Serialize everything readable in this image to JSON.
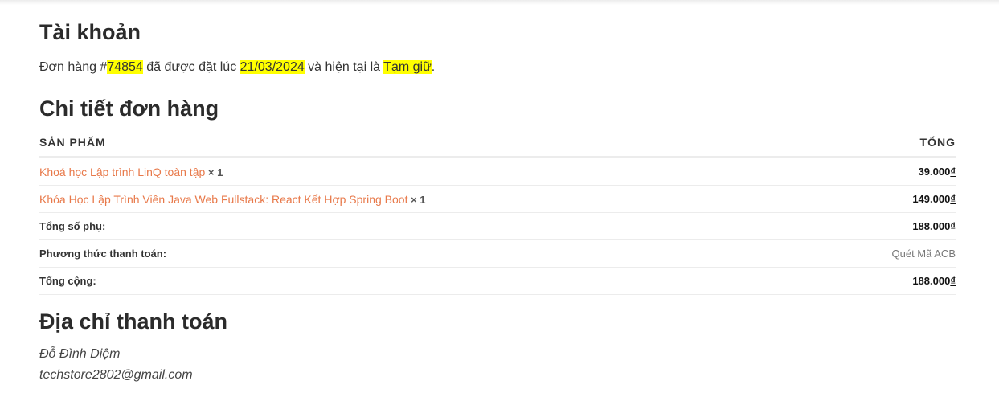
{
  "account": {
    "title": "Tài khoản",
    "notice": {
      "prefix": "Đơn hàng #",
      "order_number": "74854",
      "mid1": " đã được đặt lúc ",
      "date": "21/03/2024",
      "mid2": " và hiện tại là ",
      "status": "Tạm giữ",
      "suffix": "."
    }
  },
  "order_details": {
    "title": "Chi tiết đơn hàng",
    "headers": {
      "product": "SẢN PHẨM",
      "total": "TỔNG"
    },
    "items": [
      {
        "name": "Khoá học Lập trình LinQ toàn tập",
        "qty": "× 1",
        "amount": "39.000",
        "currency": "₫"
      },
      {
        "name": "Khóa Học Lập Trình Viên Java Web Fullstack: React Kết Hợp Spring Boot",
        "qty": "× 1",
        "amount": "149.000",
        "currency": "₫"
      }
    ],
    "subtotal": {
      "label": "Tổng số phụ:",
      "amount": "188.000",
      "currency": "₫"
    },
    "payment_method": {
      "label": "Phương thức thanh toán:",
      "value": "Quét Mã ACB"
    },
    "total": {
      "label": "Tổng cộng:",
      "amount": "188.000",
      "currency": "₫"
    }
  },
  "billing_address": {
    "title": "Địa chỉ thanh toán",
    "name": "Đỗ Đình Diệm",
    "email": "techstore2802@gmail.com"
  },
  "colors": {
    "accent_link": "#e8794a",
    "highlight": "#ffff00"
  }
}
